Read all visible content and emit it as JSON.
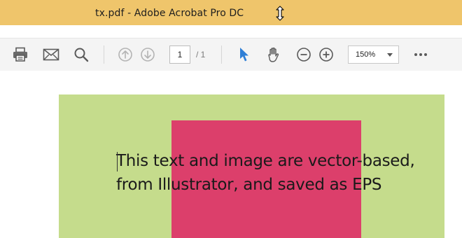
{
  "window": {
    "title": "tx.pdf - Adobe Acrobat Pro DC"
  },
  "toolbar": {
    "icons": {
      "print": "print-icon",
      "email": "mail-icon",
      "search": "search-icon",
      "page_up": "arrow-up-circle-icon",
      "page_down": "arrow-down-circle-icon",
      "select": "pointer-arrow-icon",
      "hand": "hand-icon",
      "zoom_out": "zoom-out-icon",
      "zoom_in": "zoom-in-icon",
      "more": "more-icon"
    },
    "page_number": "1",
    "page_total": "/ 1",
    "zoom": "150%"
  },
  "document": {
    "text_lines": [
      "This text and image are vector-based,",
      "from Illustrator, and saved as EPS"
    ],
    "colors": {
      "background_block": "#c5dc8c",
      "foreground_block": "#dc3f6b",
      "titlebar": "#efc56b",
      "select_tool": "#2f7fd6"
    }
  }
}
